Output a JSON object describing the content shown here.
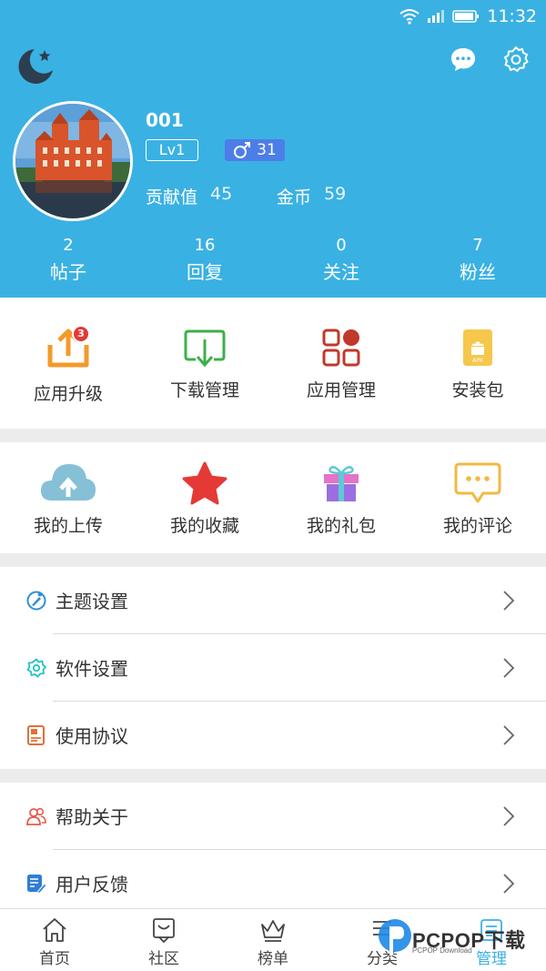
{
  "status_bar": {
    "time": "11:32"
  },
  "profile": {
    "username": "001",
    "level": "Lv1",
    "gender_value": "31",
    "contribution_label": "贡献值",
    "contribution_value": "45",
    "coins_label": "金币",
    "coins_value": "59"
  },
  "stats": [
    {
      "value": "2",
      "label": "帖子"
    },
    {
      "value": "16",
      "label": "回复"
    },
    {
      "value": "0",
      "label": "关注"
    },
    {
      "value": "7",
      "label": "粉丝"
    }
  ],
  "tools": [
    {
      "label": "应用升级",
      "badge": "3",
      "icon": "upload-box-icon",
      "color": "#f39a2b"
    },
    {
      "label": "下载管理",
      "icon": "download-icon",
      "color": "#3bb04a"
    },
    {
      "label": "应用管理",
      "icon": "apps-grid-icon",
      "color": "#c0392b"
    },
    {
      "label": "安装包",
      "icon": "apk-icon",
      "color": "#f5c84c"
    }
  ],
  "personal": [
    {
      "label": "我的上传",
      "icon": "cloud-upload-icon",
      "color": "#86c0d6"
    },
    {
      "label": "我的收藏",
      "icon": "star-icon",
      "color": "#e53935"
    },
    {
      "label": "我的礼包",
      "icon": "gift-icon",
      "color": "#9c6ee0"
    },
    {
      "label": "我的评论",
      "icon": "comment-icon",
      "color": "#f2b942"
    }
  ],
  "settings_list": [
    {
      "label": "主题设置",
      "icon": "theme-icon",
      "color": "#2e8fd8"
    },
    {
      "label": "软件设置",
      "icon": "settings-flower-icon",
      "color": "#22c3c8"
    },
    {
      "label": "使用协议",
      "icon": "agreement-icon",
      "color": "#e0703a"
    }
  ],
  "help_list": [
    {
      "label": "帮助关于",
      "icon": "users-icon",
      "color": "#e85a4f"
    },
    {
      "label": "用户反馈",
      "icon": "feedback-icon",
      "color": "#2f7dd6"
    }
  ],
  "bottom_nav": [
    {
      "label": "首页",
      "icon": "home-icon"
    },
    {
      "label": "社区",
      "icon": "community-icon"
    },
    {
      "label": "榜单",
      "icon": "crown-icon"
    },
    {
      "label": "分类",
      "icon": "category-icon"
    },
    {
      "label": "管理",
      "icon": "manage-icon",
      "active": true
    }
  ],
  "watermark": {
    "text": "PCPOP下载",
    "sub": "PCPOP Download"
  },
  "colors": {
    "header": "#3ab1e3",
    "accent": "#3ab1e3",
    "gender_badge": "#4d7de8"
  }
}
